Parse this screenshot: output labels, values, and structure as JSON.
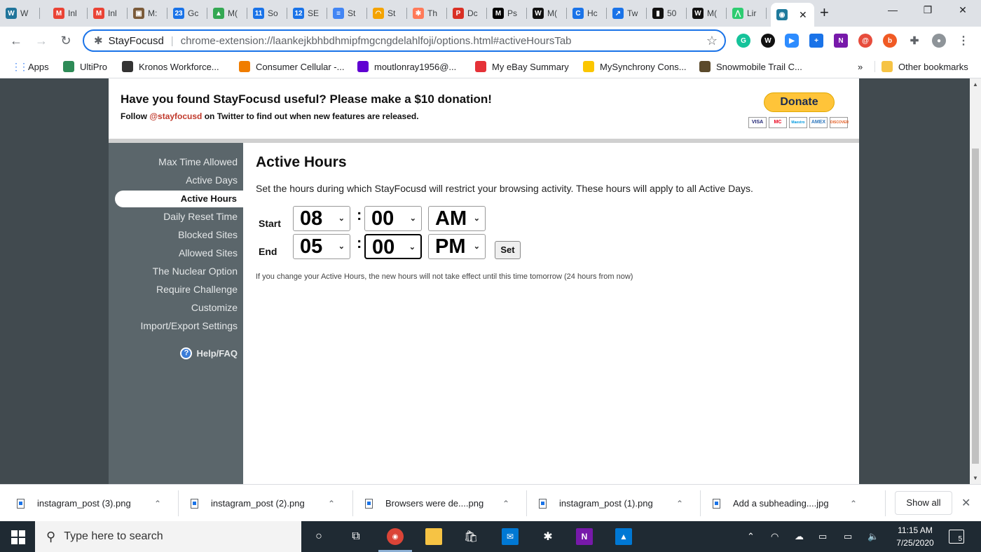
{
  "browser": {
    "tabs": [
      {
        "label": "W",
        "icon": "wordpress-icon",
        "color": "#21759b",
        "glyph": "W"
      },
      {
        "label": "Inl",
        "icon": "gmail-icon",
        "color": "#ea4335",
        "glyph": "M"
      },
      {
        "label": "Inl",
        "icon": "gmail-icon",
        "color": "#ea4335",
        "glyph": "M"
      },
      {
        "label": "M:",
        "icon": "tab-icon",
        "color": "#7b5b3a",
        "glyph": "▣"
      },
      {
        "label": "Gc",
        "icon": "calendar-icon",
        "color": "#1a73e8",
        "glyph": "23"
      },
      {
        "label": "M(",
        "icon": "drive-icon",
        "color": "#34a853",
        "glyph": "▲"
      },
      {
        "label": "So",
        "icon": "calendar-icon",
        "color": "#1a73e8",
        "glyph": "11"
      },
      {
        "label": "SE",
        "icon": "calendar-icon",
        "color": "#1a73e8",
        "glyph": "12"
      },
      {
        "label": "St",
        "icon": "docs-icon",
        "color": "#4285f4",
        "glyph": "≡"
      },
      {
        "label": "St",
        "icon": "rainbow-icon",
        "color": "#f4a300",
        "glyph": "◠"
      },
      {
        "label": "Th",
        "icon": "hubspot-icon",
        "color": "#ff7a59",
        "glyph": "✱"
      },
      {
        "label": "Dc",
        "icon": "tab-icon",
        "color": "#d93025",
        "glyph": "P"
      },
      {
        "label": "Ps",
        "icon": "medium-icon",
        "color": "#000000",
        "glyph": "M"
      },
      {
        "label": "M(",
        "icon": "tab-icon",
        "color": "#111111",
        "glyph": "W"
      },
      {
        "label": "Hc",
        "icon": "tab-icon",
        "color": "#1a73e8",
        "glyph": "C"
      },
      {
        "label": "Tw",
        "icon": "chart-icon",
        "color": "#1a73e8",
        "glyph": "↗"
      },
      {
        "label": "50",
        "icon": "tab-icon",
        "color": "#111111",
        "glyph": "▮"
      },
      {
        "label": "M(",
        "icon": "tab-icon",
        "color": "#111111",
        "glyph": "W"
      },
      {
        "label": "Lir",
        "icon": "tab-icon",
        "color": "#2ecc71",
        "glyph": "⋀"
      },
      {
        "label": "",
        "icon": "stayfocusd-icon",
        "color": "#1f7a9c",
        "glyph": "◉"
      }
    ],
    "new_tab": "+",
    "url_site": "StayFocusd",
    "url_path": "chrome-extension://laankejkbhbdhmipfmgcngdelahlfoji/options.html#activeHoursTab",
    "bookmarks": [
      {
        "label": "Apps",
        "icon": "apps-icon",
        "color": "#ea4335"
      },
      {
        "label": "UltiPro",
        "icon": "ultipro-icon",
        "color": "#2e8b57"
      },
      {
        "label": "Kronos Workforce...",
        "icon": "globe-icon",
        "color": "#333333"
      },
      {
        "label": "Consumer Cellular -...",
        "icon": "consumer-cellular-icon",
        "color": "#f07d00"
      },
      {
        "label": "moutlonray1956@...",
        "icon": "yahoo-mail-icon",
        "color": "#6001d2"
      },
      {
        "label": "My eBay Summary",
        "icon": "ebay-icon",
        "color": "#e53238"
      },
      {
        "label": "MySynchrony Cons...",
        "icon": "synchrony-icon",
        "color": "#fbc600"
      },
      {
        "label": "Snowmobile Trail C...",
        "icon": "wisconsin-icon",
        "color": "#5b4a2c"
      }
    ],
    "bookmarks_overflow": "»",
    "other_bookmarks": "Other bookmarks"
  },
  "donate": {
    "title": "Have you found StayFocusd useful? Please make a $10 donation!",
    "follow_prefix": "Follow ",
    "twitter_handle": "@stayfocusd",
    "follow_suffix": " on Twitter to find out when new features are released.",
    "button_label": "Donate",
    "cards": [
      "VISA",
      "MC",
      "Maestro",
      "AMEX",
      "DISCOVER"
    ]
  },
  "sidebar": {
    "items": [
      "Max Time Allowed",
      "Active Days",
      "Active Hours",
      "Daily Reset Time",
      "Blocked Sites",
      "Allowed Sites",
      "The Nuclear Option",
      "Require Challenge",
      "Customize",
      "Import/Export Settings"
    ],
    "active": "Active Hours",
    "help": "Help/FAQ"
  },
  "main": {
    "title": "Active Hours",
    "description": "Set the hours during which StayFocusd will restrict your browsing activity. These hours will apply to all Active Days.",
    "start_label": "Start",
    "end_label": "End",
    "start_hour": "08",
    "start_minute": "00",
    "start_period": "AM",
    "end_hour": "05",
    "end_minute": "00",
    "end_period": "PM",
    "colon": ":",
    "set_button": "Set",
    "note": "If you change your Active Hours, the new hours will not take effect until this time tomorrow (24 hours from now)"
  },
  "downloads": {
    "items": [
      "instagram_post (3).png",
      "instagram_post (2).png",
      "Browsers were de....png",
      "instagram_post (1).png",
      "Add a subheading....jpg"
    ],
    "show_all": "Show all"
  },
  "taskbar": {
    "search_placeholder": "Type here to search",
    "time": "11:15 AM",
    "date": "7/25/2020",
    "notifications": "5"
  }
}
